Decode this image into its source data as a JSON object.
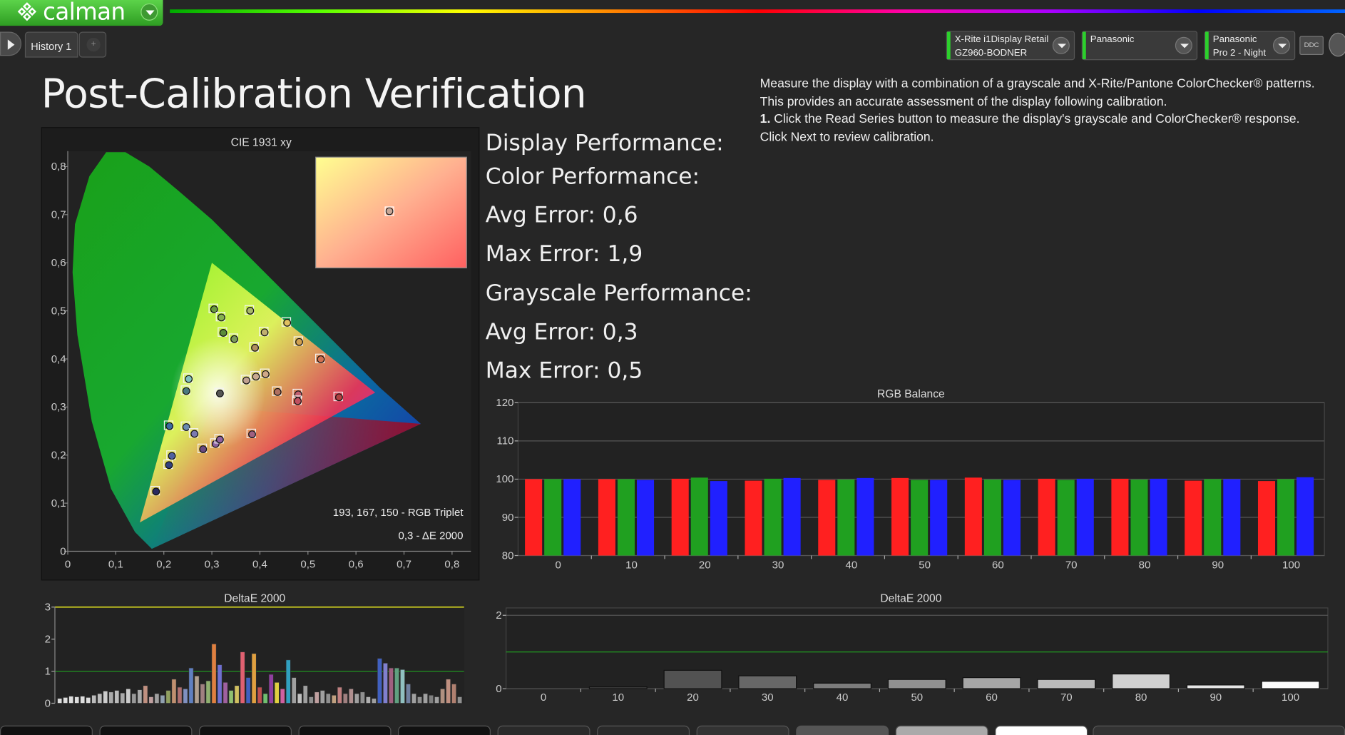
{
  "app": {
    "logo_text": "calman"
  },
  "tabs": [
    {
      "label": "History 1"
    }
  ],
  "devices": [
    {
      "line1": "X-Rite i1Display Retail",
      "line2": "GZ960-BODNER"
    },
    {
      "line1": "Panasonic",
      "line2": ""
    },
    {
      "line1": "Panasonic",
      "line2": "Pro 2 - Night"
    }
  ],
  "toolbar": {
    "ddc_label": "DDC"
  },
  "page": {
    "title": "Post-Calibration Verification",
    "instructions": {
      "line1": "Measure the display with a combination of a grayscale and X-Rite/Pantone ColorChecker® patterns.",
      "line2": "This provides an accurate assessment of the display following calibration.",
      "step_number": "1.",
      "line3": " Click the Read Series button to measure the display's grayscale and ColorChecker® response.",
      "line4": "Click Next to review calibration."
    }
  },
  "performance": {
    "display": "Display Performance:",
    "color": "Color Performance:",
    "color_avg": "Avg Error: 0,6",
    "color_max": "Max Error: 1,9",
    "grayscale": "Grayscale Performance:",
    "gray_avg": "Avg Error: 0,3",
    "gray_max": "Max Error: 0,5"
  },
  "cie": {
    "title": "CIE 1931 xy",
    "rgb_triplet": "193, 167, 150 - RGB Triplet",
    "delta_e": "0,3 - ΔE 2000",
    "colors": {
      "accent_green": "#2cd02c",
      "plot_bg": "#222222"
    }
  },
  "chart_data": [
    {
      "type": "scatter",
      "title": "CIE 1931 xy",
      "xlim": [
        0,
        0.85
      ],
      "ylim": [
        0,
        0.85
      ],
      "x_ticks": [
        "0",
        "0,1",
        "0,2",
        "0,3",
        "0,4",
        "0,5",
        "0,6",
        "0,7",
        "0,8"
      ],
      "y_ticks": [
        "0",
        "0,1",
        "0,2",
        "0,3",
        "0,4",
        "0,5",
        "0,6",
        "0,7",
        "0,8"
      ],
      "gamut_triangle": [
        [
          0.64,
          0.33
        ],
        [
          0.3,
          0.6
        ],
        [
          0.15,
          0.06
        ]
      ],
      "points": [
        {
          "x": 0.303,
          "y": 0.505,
          "c": "#6a9a40"
        },
        {
          "x": 0.318,
          "y": 0.488,
          "c": "#86b050"
        },
        {
          "x": 0.322,
          "y": 0.456,
          "c": "#5b8a3a"
        },
        {
          "x": 0.345,
          "y": 0.443,
          "c": "#7b9a5a"
        },
        {
          "x": 0.378,
          "y": 0.502,
          "c": "#a8b868"
        },
        {
          "x": 0.388,
          "y": 0.425,
          "c": "#b09060"
        },
        {
          "x": 0.408,
          "y": 0.457,
          "c": "#c0b070"
        },
        {
          "x": 0.455,
          "y": 0.477,
          "c": "#e0c060"
        },
        {
          "x": 0.48,
          "y": 0.437,
          "c": "#d0a050"
        },
        {
          "x": 0.525,
          "y": 0.401,
          "c": "#d07050"
        },
        {
          "x": 0.25,
          "y": 0.36,
          "c": "#80c0c0"
        },
        {
          "x": 0.245,
          "y": 0.335,
          "c": "#4a7a80"
        },
        {
          "x": 0.315,
          "y": 0.33,
          "c": "#555555"
        },
        {
          "x": 0.37,
          "y": 0.357,
          "c": "#c0a090"
        },
        {
          "x": 0.39,
          "y": 0.365,
          "c": "#c8a890"
        },
        {
          "x": 0.41,
          "y": 0.37,
          "c": "#d0a888"
        },
        {
          "x": 0.435,
          "y": 0.333,
          "c": "#b07060"
        },
        {
          "x": 0.478,
          "y": 0.328,
          "c": "#c06070"
        },
        {
          "x": 0.477,
          "y": 0.314,
          "c": "#c05060"
        },
        {
          "x": 0.563,
          "y": 0.322,
          "c": "#b04040"
        },
        {
          "x": 0.21,
          "y": 0.262,
          "c": "#3a6aa0"
        },
        {
          "x": 0.245,
          "y": 0.26,
          "c": "#6a8ab0"
        },
        {
          "x": 0.262,
          "y": 0.246,
          "c": "#7a7ab0"
        },
        {
          "x": 0.28,
          "y": 0.214,
          "c": "#6a4a80"
        },
        {
          "x": 0.306,
          "y": 0.225,
          "c": "#8a60a0"
        },
        {
          "x": 0.315,
          "y": 0.234,
          "c": "#9060a0"
        },
        {
          "x": 0.382,
          "y": 0.245,
          "c": "#a06080"
        },
        {
          "x": 0.215,
          "y": 0.2,
          "c": "#5060a0"
        },
        {
          "x": 0.209,
          "y": 0.181,
          "c": "#304080"
        },
        {
          "x": 0.182,
          "y": 0.126,
          "c": "#2a2a60"
        }
      ]
    },
    {
      "type": "bar",
      "title": "RGB Balance",
      "categories": [
        "0",
        "10",
        "20",
        "30",
        "40",
        "50",
        "60",
        "70",
        "80",
        "90",
        "100"
      ],
      "ylim": [
        80,
        120
      ],
      "y_ticks": [
        "80",
        "90",
        "100",
        "110",
        "120"
      ],
      "series": [
        {
          "name": "R",
          "color": "#ff2020",
          "values": [
            100.0,
            100.0,
            100.1,
            99.6,
            99.8,
            100.3,
            100.4,
            100.1,
            100.1,
            99.6,
            99.5
          ]
        },
        {
          "name": "G",
          "color": "#20a020",
          "values": [
            100.0,
            100.0,
            100.4,
            100.1,
            99.9,
            99.8,
            99.9,
            99.8,
            99.9,
            100.0,
            100.0
          ]
        },
        {
          "name": "B",
          "color": "#2020ff",
          "values": [
            100.0,
            99.8,
            99.5,
            100.3,
            100.3,
            99.8,
            99.8,
            100.1,
            100.1,
            100.0,
            100.5
          ]
        }
      ]
    },
    {
      "type": "bar",
      "title": "DeltaE 2000",
      "ylim": [
        0,
        3
      ],
      "y_ticks": [
        "0",
        "1",
        "2",
        "3"
      ],
      "threshold": 1,
      "values": [
        0.15,
        0.18,
        0.22,
        0.2,
        0.22,
        0.18,
        0.25,
        0.3,
        0.38,
        0.35,
        0.4,
        0.32,
        0.45,
        0.3,
        0.42,
        0.55,
        0.2,
        0.3,
        0.25,
        0.4,
        0.75,
        0.5,
        0.45,
        1.1,
        0.85,
        0.6,
        0.7,
        1.85,
        1.2,
        0.65,
        0.4,
        0.55,
        1.6,
        0.8,
        1.55,
        0.5,
        0.3,
        0.9,
        0.65,
        0.45,
        1.35,
        0.8,
        0.3,
        0.55,
        0.2,
        0.35,
        0.4,
        0.3,
        0.25,
        0.5,
        0.3,
        0.45,
        0.3,
        0.35,
        0.2,
        0.15,
        1.4,
        1.25,
        1.1,
        1.1,
        1.05,
        0.6,
        0.3,
        0.2,
        0.3,
        0.25,
        0.2,
        0.45,
        0.75,
        0.6,
        0.2
      ],
      "colors": [
        "#ddd",
        "#ddd",
        "#ddd",
        "#ddd",
        "#ddd",
        "#ddd",
        "#bbb",
        "#bbb",
        "#ccc",
        "#aaa",
        "#bbb",
        "#aaa",
        "#ccc",
        "#999",
        "#aaa",
        "#c09080",
        "#c0a0a0",
        "#a0a0a0",
        "#90a0b0",
        "#90a060",
        "#c09070",
        "#b07070",
        "#8090c0",
        "#6080c0",
        "#b0a090",
        "#a08080",
        "#90b070",
        "#e08040",
        "#7070d0",
        "#a060a0",
        "#90c070",
        "#d0c060",
        "#e06070",
        "#4060c0",
        "#e0a040",
        "#c05050",
        "#70c070",
        "#9040a0",
        "#e0d040",
        "#d060a0",
        "#30a0c0",
        "#a0a0a0",
        "#c0c0c0",
        "#a0a0a0",
        "#909090",
        "#c0a0a0",
        "#a0a0a0",
        "#909090",
        "#c0a080",
        "#c08080",
        "#a08080",
        "#b09090",
        "#a0a0a0",
        "#909090",
        "#b0b0b0",
        "#a0a0a0",
        "#4060c0",
        "#8080d0",
        "#a06080",
        "#60a080",
        "#90c0c0",
        "#7080a0",
        "#a0a0a0",
        "#909090",
        "#a0a0a0",
        "#808080",
        "#a0a0a0",
        "#b09080",
        "#c09080",
        "#b08070",
        "#909090"
      ]
    },
    {
      "type": "bar",
      "title": "DeltaE 2000",
      "categories": [
        "0",
        "10",
        "20",
        "30",
        "40",
        "50",
        "60",
        "70",
        "80",
        "90",
        "100"
      ],
      "ylim": [
        0,
        2.2
      ],
      "y_ticks": [
        "0",
        "2"
      ],
      "threshold": 1,
      "values": [
        0.0,
        0.05,
        0.5,
        0.35,
        0.15,
        0.25,
        0.3,
        0.25,
        0.4,
        0.1,
        0.2
      ]
    }
  ]
}
